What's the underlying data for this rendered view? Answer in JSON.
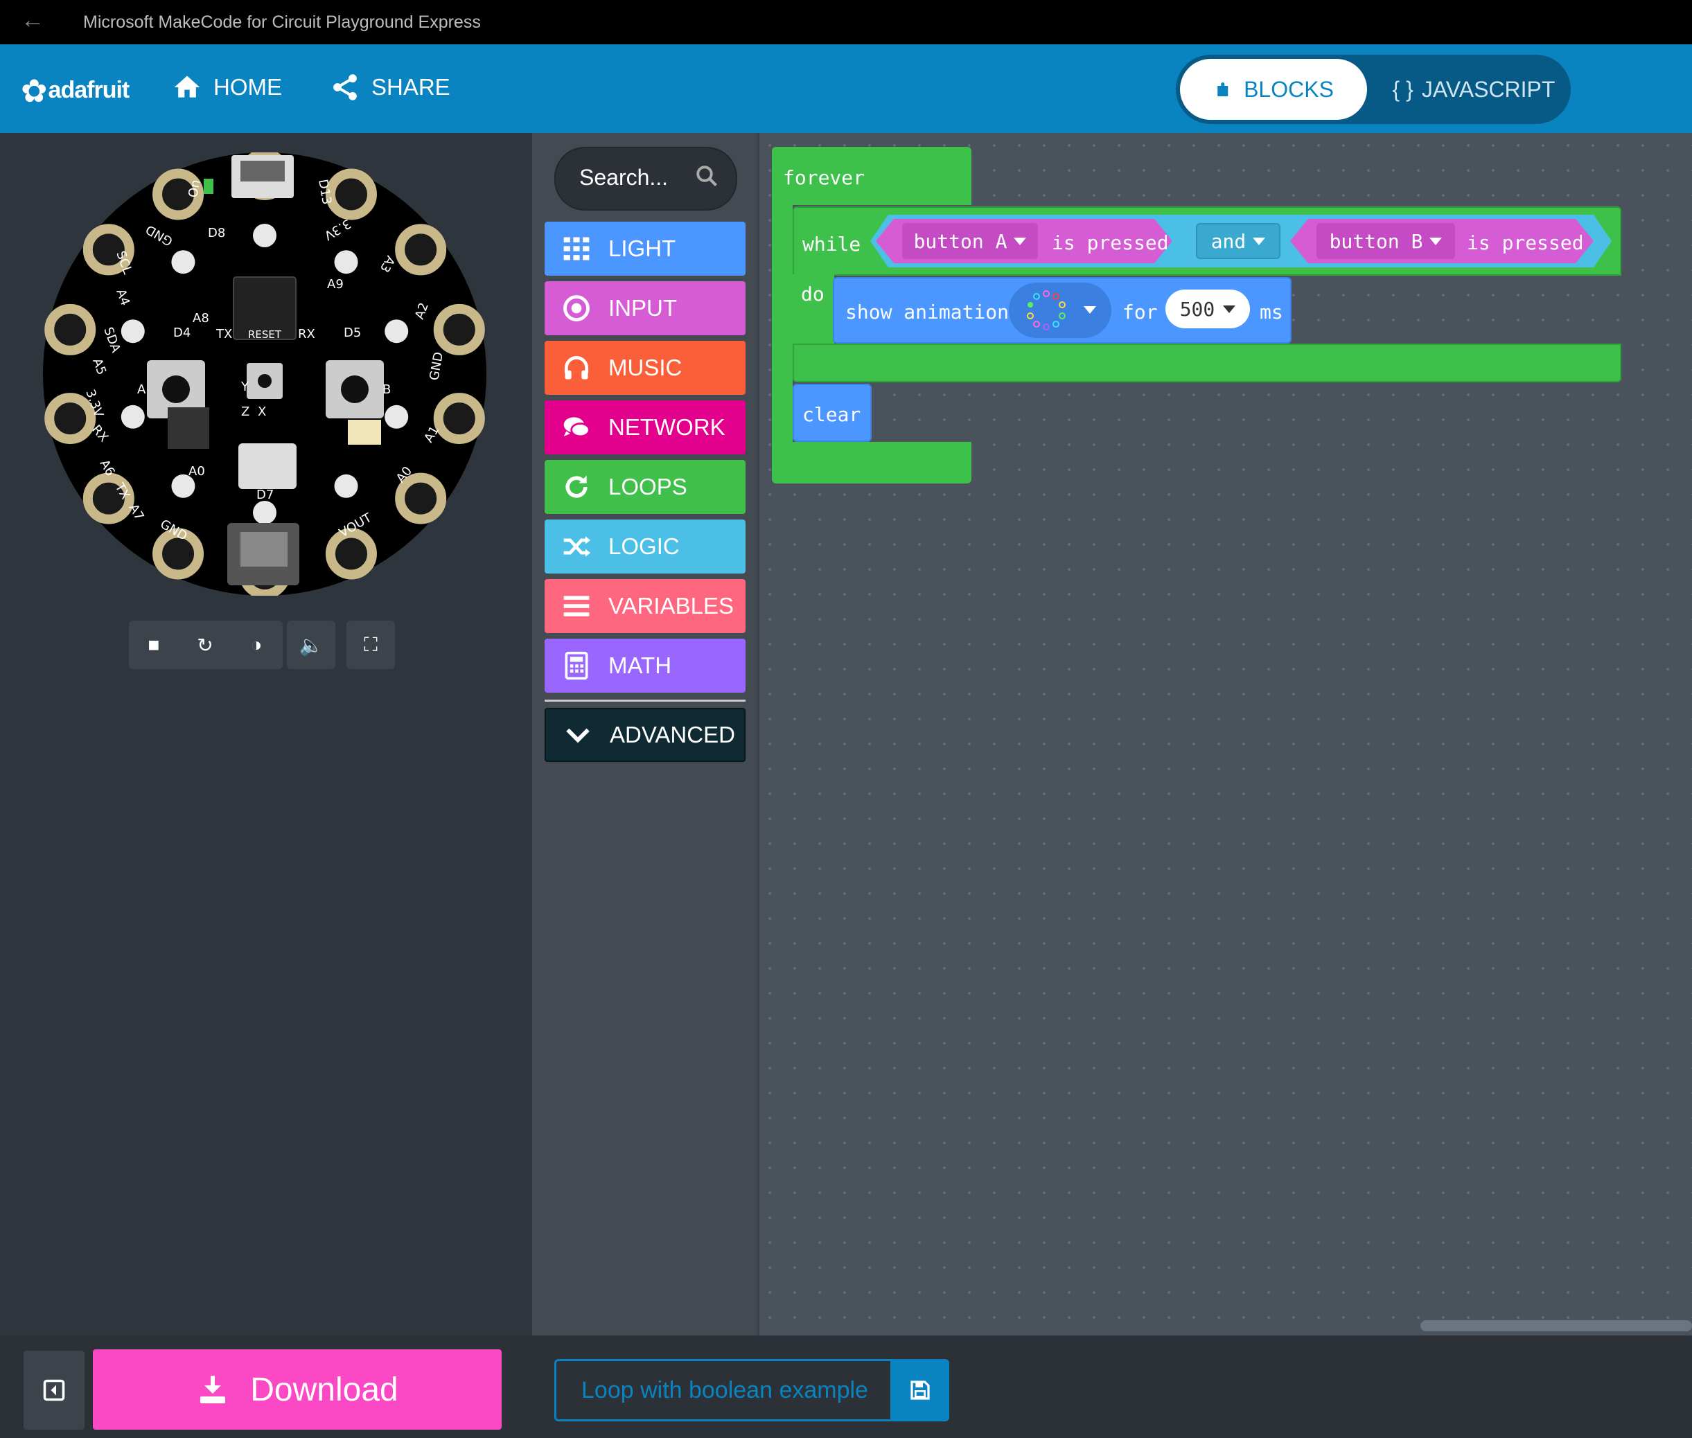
{
  "window": {
    "title": "Microsoft MakeCode for Circuit Playground Express"
  },
  "menubar": {
    "logo": "adafruit",
    "home_label": "HOME",
    "share_label": "SHARE",
    "blocks_label": "BLOCKS",
    "javascript_label": "JAVASCRIPT",
    "javascript_prefix": "{ }"
  },
  "simulator": {
    "board_labels": [
      "On",
      "D13",
      "GND",
      "D8",
      "3.3V",
      "SCL",
      "A3",
      "A9",
      "A4",
      "A2",
      "SDA",
      "A8",
      "A5",
      "D4",
      "TX",
      "RESET",
      "RX",
      "D5",
      "GND",
      "3.3V",
      "A",
      "B",
      "Y",
      "Z",
      "X",
      "RX",
      "A6",
      "A1",
      "TX",
      "A0",
      "A7",
      "D7",
      "GND",
      "A0",
      "VOUT"
    ],
    "tools": [
      "stop",
      "restart",
      "slow-mo",
      "mute",
      "fullscreen"
    ]
  },
  "toolbox": {
    "search_placeholder": "Search...",
    "categories": [
      {
        "label": "LIGHT",
        "color": "#4c97ff",
        "icon": "grid-icon"
      },
      {
        "label": "INPUT",
        "color": "#d65cd6",
        "icon": "target-icon"
      },
      {
        "label": "MUSIC",
        "color": "#fa5f3a",
        "icon": "headphones-icon"
      },
      {
        "label": "NETWORK",
        "color": "#e3008c",
        "icon": "chat-icon"
      },
      {
        "label": "LOOPS",
        "color": "#40bf4a",
        "icon": "refresh-icon"
      },
      {
        "label": "LOGIC",
        "color": "#4cbfe6",
        "icon": "shuffle-icon"
      },
      {
        "label": "VARIABLES",
        "color": "#ff6680",
        "icon": "list-icon"
      },
      {
        "label": "MATH",
        "color": "#9966ff",
        "icon": "calculator-icon"
      }
    ],
    "advanced_label": "ADVANCED"
  },
  "workspace": {
    "forever": "forever",
    "while": "while",
    "do": "do",
    "button_a": "button A",
    "is_pressed_1": "is pressed",
    "and": "and",
    "button_b": "button B",
    "is_pressed_2": "is pressed",
    "show_animation": "show animation",
    "for": "for",
    "ms_value": "500",
    "ms": "ms",
    "clear": "clear"
  },
  "bottom": {
    "download_label": "Download",
    "project_name": "Loop with boolean example"
  },
  "colors": {
    "menubar": "#0a84c1",
    "loops_green": "#3ec14a",
    "input_magenta": "#d65cd6",
    "logic_cyan": "#4cbfe6",
    "light_blue": "#4c97ff",
    "download_pink": "#fb48c4"
  }
}
